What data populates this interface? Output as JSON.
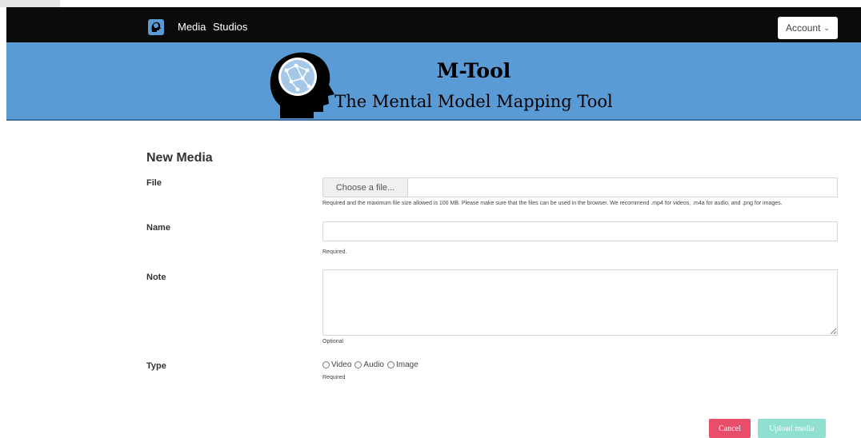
{
  "navbar": {
    "logo_icon": "brain-head-logo-icon",
    "links": [
      "Media",
      "Studios"
    ],
    "account_label": "Account",
    "account_icon": "chevron-down-icon"
  },
  "banner": {
    "title": "M-Tool",
    "subtitle": "The Mental Model Mapping Tool",
    "image": "brain-head-silhouette",
    "bg_color": "#5b9bd5"
  },
  "form": {
    "title": "New Media",
    "file": {
      "label": "File",
      "button": "Choose a file...",
      "help": "Required and the maximum file size allowed is 100 MB. Please make sure that the files can be used in the browser. We recommend .mp4 for videos, .m4a for audio, and .png for images."
    },
    "name": {
      "label": "Name",
      "value": "",
      "help": "Required."
    },
    "note": {
      "label": "Note",
      "value": "",
      "help": "Optional"
    },
    "type": {
      "label": "Type",
      "options": [
        "Video",
        "Audio",
        "Image"
      ],
      "selected": null,
      "help": "Required"
    }
  },
  "actions": {
    "cancel": "Cancel",
    "upload": "Upload media",
    "cancel_color": "#e84d6a",
    "upload_color": "#8fe0d0"
  }
}
